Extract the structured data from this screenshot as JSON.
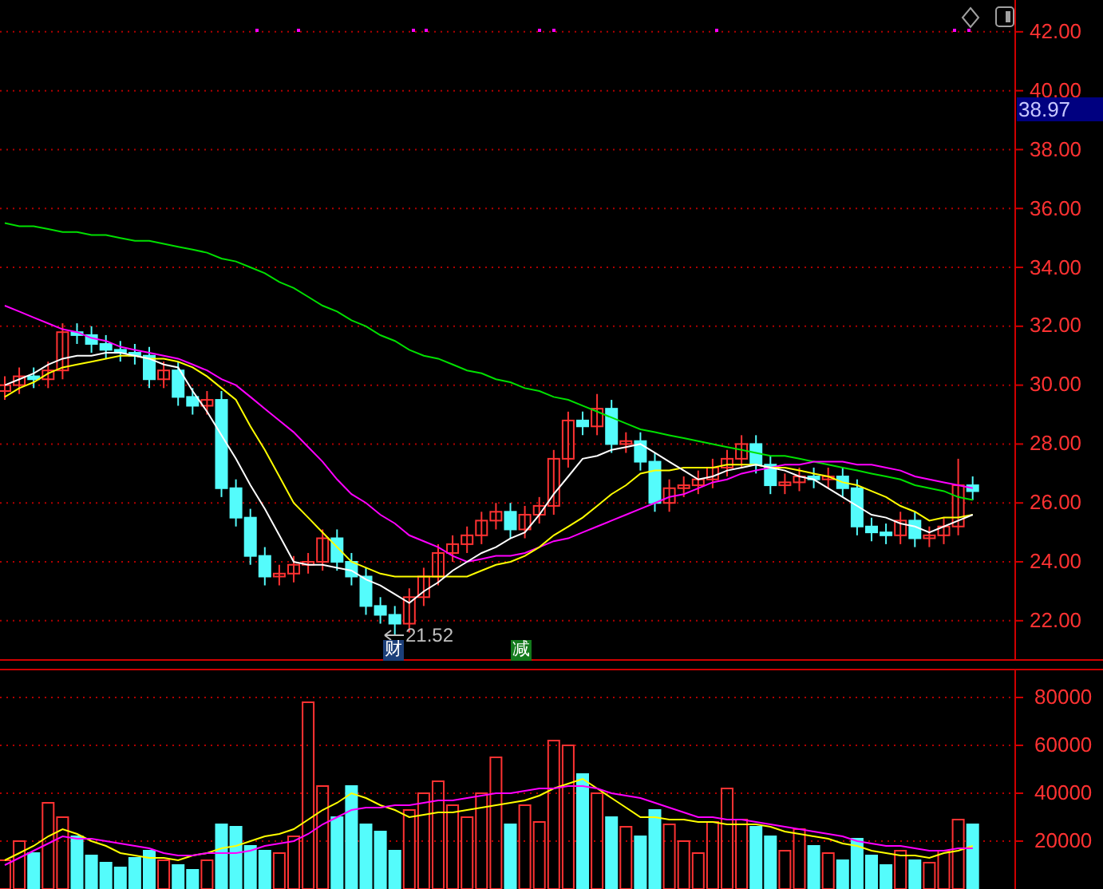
{
  "price_chart": {
    "chart_data": {
      "type": "candlestick",
      "grid": true,
      "ylim": [
        20.64,
        43.08
      ],
      "yticks": [
        {
          "value": 42,
          "label": "42.00"
        },
        {
          "value": 40,
          "label": "40.00"
        },
        {
          "value": 38,
          "label": "38.00"
        },
        {
          "value": 36,
          "label": "36.00"
        },
        {
          "value": 34,
          "label": "34.00"
        },
        {
          "value": 32,
          "label": "32.00"
        },
        {
          "value": 30,
          "label": "30.00"
        },
        {
          "value": 28,
          "label": "28.00"
        },
        {
          "value": 26,
          "label": "26.00"
        },
        {
          "value": 24,
          "label": "24.00"
        },
        {
          "value": 22,
          "label": "22.00"
        }
      ],
      "ohlc": [
        [
          29.8,
          30.3,
          29.5,
          30.0
        ],
        [
          30.0,
          30.6,
          29.7,
          30.3
        ],
        [
          30.3,
          30.6,
          29.9,
          30.2
        ],
        [
          30.2,
          30.8,
          29.9,
          30.5
        ],
        [
          30.5,
          32.1,
          30.2,
          31.8
        ],
        [
          31.8,
          32.1,
          31.4,
          31.7
        ],
        [
          31.7,
          32.0,
          31.1,
          31.4
        ],
        [
          31.4,
          31.7,
          30.9,
          31.2
        ],
        [
          31.2,
          31.5,
          30.8,
          31.1
        ],
        [
          31.1,
          31.4,
          30.7,
          31.0
        ],
        [
          31.0,
          31.3,
          29.9,
          30.2
        ],
        [
          30.2,
          30.8,
          29.9,
          30.5
        ],
        [
          30.5,
          30.8,
          29.3,
          29.6
        ],
        [
          29.6,
          29.9,
          29.0,
          29.3
        ],
        [
          29.3,
          29.8,
          29.0,
          29.5
        ],
        [
          29.5,
          29.8,
          26.2,
          26.5
        ],
        [
          26.5,
          26.8,
          25.2,
          25.5
        ],
        [
          25.5,
          25.8,
          23.9,
          24.2
        ],
        [
          24.2,
          24.5,
          23.2,
          23.5
        ],
        [
          23.5,
          23.9,
          23.2,
          23.6
        ],
        [
          23.6,
          24.2,
          23.3,
          23.9
        ],
        [
          23.9,
          24.3,
          23.6,
          24.0
        ],
        [
          24.0,
          25.1,
          23.7,
          24.8
        ],
        [
          24.8,
          25.1,
          23.7,
          24.0
        ],
        [
          24.0,
          24.3,
          23.2,
          23.5
        ],
        [
          23.5,
          23.8,
          22.2,
          22.5
        ],
        [
          22.5,
          22.8,
          21.9,
          22.2
        ],
        [
          22.2,
          22.5,
          21.52,
          21.9
        ],
        [
          21.9,
          23.1,
          21.6,
          22.8
        ],
        [
          22.8,
          23.8,
          22.5,
          23.5
        ],
        [
          23.5,
          24.6,
          23.2,
          24.3
        ],
        [
          24.3,
          24.9,
          24.0,
          24.6
        ],
        [
          24.6,
          25.2,
          24.3,
          24.9
        ],
        [
          24.9,
          25.7,
          24.6,
          25.4
        ],
        [
          25.4,
          26.0,
          25.1,
          25.7
        ],
        [
          25.7,
          26.0,
          24.8,
          25.1
        ],
        [
          25.1,
          25.9,
          24.8,
          25.6
        ],
        [
          25.6,
          26.2,
          25.3,
          25.9
        ],
        [
          25.9,
          27.8,
          25.6,
          27.5
        ],
        [
          27.5,
          29.1,
          27.2,
          28.8
        ],
        [
          28.8,
          29.1,
          28.3,
          28.6
        ],
        [
          28.6,
          29.7,
          28.3,
          29.2
        ],
        [
          29.2,
          29.5,
          27.7,
          28.0
        ],
        [
          28.0,
          28.4,
          27.7,
          28.1
        ],
        [
          28.1,
          28.4,
          27.1,
          27.4
        ],
        [
          27.4,
          27.7,
          25.7,
          26.0
        ],
        [
          26.0,
          26.8,
          25.7,
          26.5
        ],
        [
          26.5,
          26.9,
          26.2,
          26.6
        ],
        [
          26.6,
          27.1,
          26.3,
          26.8
        ],
        [
          26.8,
          27.5,
          26.5,
          27.2
        ],
        [
          27.2,
          27.8,
          26.9,
          27.5
        ],
        [
          27.5,
          28.3,
          27.2,
          28.0
        ],
        [
          28.0,
          28.3,
          27.0,
          27.3
        ],
        [
          27.3,
          27.6,
          26.3,
          26.6
        ],
        [
          26.6,
          27.0,
          26.3,
          26.7
        ],
        [
          26.7,
          27.2,
          26.4,
          26.9
        ],
        [
          26.9,
          27.2,
          26.5,
          26.8
        ],
        [
          26.8,
          27.2,
          26.5,
          26.9
        ],
        [
          26.9,
          27.2,
          26.2,
          26.5
        ],
        [
          26.5,
          26.8,
          24.9,
          25.2
        ],
        [
          25.2,
          25.5,
          24.7,
          25.0
        ],
        [
          25.0,
          25.3,
          24.6,
          24.9
        ],
        [
          24.9,
          25.7,
          24.6,
          25.4
        ],
        [
          25.4,
          25.7,
          24.5,
          24.8
        ],
        [
          24.8,
          25.2,
          24.5,
          24.9
        ],
        [
          24.9,
          25.5,
          24.6,
          25.2
        ],
        [
          25.2,
          27.5,
          24.9,
          26.6
        ],
        [
          26.6,
          26.9,
          26.1,
          26.4
        ]
      ],
      "series": [
        {
          "type": "line",
          "color": "#00e000",
          "values": [
            35.5,
            35.4,
            35.4,
            35.3,
            35.2,
            35.2,
            35.1,
            35.1,
            35.0,
            34.9,
            34.9,
            34.8,
            34.7,
            34.6,
            34.5,
            34.3,
            34.2,
            34.0,
            33.8,
            33.5,
            33.3,
            33.0,
            32.7,
            32.5,
            32.2,
            32.0,
            31.7,
            31.5,
            31.2,
            31.0,
            30.9,
            30.7,
            30.5,
            30.4,
            30.2,
            30.1,
            29.9,
            29.8,
            29.6,
            29.5,
            29.3,
            29.1,
            28.9,
            28.7,
            28.5,
            28.4,
            28.3,
            28.2,
            28.1,
            28.0,
            27.9,
            27.8,
            27.7,
            27.6,
            27.6,
            27.5,
            27.4,
            27.3,
            27.2,
            27.1,
            27.0,
            26.9,
            26.8,
            26.6,
            26.5,
            26.4,
            26.2,
            26.1
          ]
        },
        {
          "type": "line",
          "color": "#ff00ff",
          "values": [
            32.7,
            32.5,
            32.3,
            32.1,
            31.9,
            31.8,
            31.6,
            31.5,
            31.3,
            31.2,
            31.1,
            31.0,
            30.9,
            30.7,
            30.5,
            30.2,
            30.0,
            29.6,
            29.2,
            28.8,
            28.4,
            27.9,
            27.4,
            26.8,
            26.3,
            26.0,
            25.6,
            25.3,
            24.9,
            24.7,
            24.5,
            24.2,
            24.0,
            24.1,
            24.2,
            24.2,
            24.3,
            24.5,
            24.7,
            24.8,
            25.0,
            25.2,
            25.4,
            25.6,
            25.8,
            26.0,
            26.2,
            26.3,
            26.5,
            26.7,
            26.8,
            27.0,
            27.1,
            27.2,
            27.3,
            27.3,
            27.4,
            27.4,
            27.4,
            27.3,
            27.3,
            27.2,
            27.1,
            26.9,
            26.8,
            26.7,
            26.6,
            26.5
          ]
        },
        {
          "type": "line",
          "color": "#ffff00",
          "values": [
            29.6,
            29.9,
            30.1,
            30.4,
            30.6,
            30.7,
            30.8,
            30.9,
            31.0,
            31.0,
            30.9,
            30.9,
            30.8,
            30.6,
            30.3,
            29.9,
            29.5,
            28.6,
            27.8,
            26.9,
            26.0,
            25.5,
            25.0,
            24.5,
            24.0,
            23.8,
            23.6,
            23.5,
            23.5,
            23.5,
            23.5,
            23.5,
            23.5,
            23.7,
            23.9,
            24.0,
            24.2,
            24.5,
            24.9,
            25.2,
            25.5,
            25.9,
            26.3,
            26.6,
            27.0,
            27.1,
            27.1,
            27.2,
            27.2,
            27.2,
            27.3,
            27.3,
            27.3,
            27.2,
            27.2,
            27.1,
            27.0,
            26.9,
            26.7,
            26.6,
            26.4,
            26.2,
            25.9,
            25.7,
            25.4,
            25.5,
            25.5,
            25.6
          ]
        },
        {
          "type": "line",
          "color": "#ffffff",
          "values": [
            30.0,
            30.2,
            30.4,
            30.7,
            30.9,
            31.0,
            31.0,
            31.1,
            31.1,
            31.0,
            30.9,
            30.7,
            30.6,
            29.8,
            29.1,
            28.3,
            27.5,
            26.6,
            25.8,
            24.9,
            24.0,
            23.9,
            23.9,
            23.8,
            23.7,
            23.4,
            23.2,
            22.9,
            22.6,
            23.0,
            23.3,
            23.7,
            24.0,
            24.3,
            24.5,
            24.8,
            25.0,
            25.6,
            26.3,
            26.9,
            27.5,
            27.6,
            27.8,
            27.9,
            28.0,
            27.7,
            27.4,
            27.1,
            26.8,
            26.9,
            27.1,
            27.2,
            27.3,
            27.2,
            27.1,
            26.9,
            26.8,
            26.5,
            26.2,
            25.9,
            25.6,
            25.5,
            25.3,
            25.2,
            25.0,
            25.2,
            25.4,
            25.6
          ]
        }
      ]
    }
  },
  "current_price": "38.97",
  "low_marker": {
    "label": "21.52"
  },
  "event_badges": [
    {
      "label": "财",
      "color": "#1c3f7a"
    },
    {
      "label": "减",
      "color": "#137a1c"
    }
  ],
  "volume_chart": {
    "chart_data": {
      "type": "bar",
      "grid": true,
      "ylim": [
        0,
        92000
      ],
      "yticks": [
        {
          "value": 80000,
          "label": "80000"
        },
        {
          "value": 60000,
          "label": "60000"
        },
        {
          "value": 40000,
          "label": "40000"
        },
        {
          "value": 20000,
          "label": "20000"
        }
      ],
      "series": [
        {
          "color": "#ff3232",
          "values": [
            12000,
            20000,
            null,
            36000,
            30000,
            null,
            null,
            null,
            null,
            null,
            null,
            12000,
            null,
            null,
            12000,
            null,
            null,
            null,
            null,
            15000,
            22000,
            78000,
            43000,
            null,
            null,
            null,
            null,
            null,
            33000,
            40000,
            45000,
            35000,
            30000,
            40000,
            55000,
            null,
            35000,
            28000,
            62000,
            60000,
            null,
            40000,
            null,
            26000,
            null,
            null,
            27000,
            20000,
            15000,
            28000,
            42000,
            29000,
            null,
            null,
            16000,
            25000,
            null,
            15000,
            null,
            null,
            null,
            null,
            16000,
            null,
            11000,
            16000,
            29000,
            null
          ]
        },
        {
          "color": "#54fcfc",
          "values": [
            null,
            null,
            15000,
            null,
            null,
            22000,
            14000,
            11000,
            9000,
            13000,
            16000,
            null,
            10000,
            8000,
            null,
            27000,
            26000,
            18000,
            16000,
            null,
            null,
            null,
            null,
            30000,
            43000,
            27000,
            24000,
            16000,
            null,
            null,
            null,
            null,
            null,
            null,
            null,
            27000,
            null,
            null,
            null,
            null,
            48000,
            null,
            30000,
            null,
            22000,
            33000,
            null,
            null,
            null,
            null,
            null,
            null,
            26000,
            22000,
            null,
            null,
            18000,
            null,
            12000,
            21000,
            14000,
            10000,
            null,
            12000,
            null,
            null,
            null,
            27000
          ]
        },
        {
          "type": "line",
          "color": "#ffff00",
          "values": [
            12000,
            15000,
            18000,
            22000,
            25000,
            23000,
            20000,
            18000,
            15000,
            14000,
            13000,
            13000,
            12000,
            14000,
            15000,
            17000,
            18000,
            20000,
            22000,
            23000,
            25000,
            29000,
            33000,
            36000,
            40000,
            38000,
            35000,
            33000,
            30000,
            31000,
            32000,
            32000,
            33000,
            34000,
            35000,
            36000,
            37000,
            39000,
            42000,
            44000,
            46000,
            42000,
            38000,
            34000,
            30000,
            30000,
            29000,
            29000,
            28000,
            28000,
            27000,
            27000,
            27000,
            26000,
            24000,
            23000,
            22000,
            21000,
            19000,
            18000,
            16000,
            15000,
            14000,
            14000,
            13000,
            15000,
            16000,
            18000
          ]
        },
        {
          "type": "line",
          "color": "#ff00ff",
          "values": [
            10000,
            13000,
            16000,
            19000,
            22000,
            21000,
            21000,
            20000,
            19000,
            18000,
            17000,
            15000,
            14000,
            14000,
            15000,
            15000,
            15000,
            16000,
            18000,
            19000,
            20000,
            23000,
            27000,
            30000,
            33000,
            34000,
            34000,
            35000,
            35000,
            36000,
            37000,
            37000,
            38000,
            39000,
            40000,
            40000,
            41000,
            42000,
            42000,
            43000,
            43000,
            42000,
            40000,
            39000,
            38000,
            36000,
            34000,
            32000,
            30000,
            30000,
            29000,
            29000,
            28000,
            27000,
            26000,
            25000,
            24000,
            23000,
            22000,
            20000,
            19000,
            18000,
            18000,
            17000,
            16000,
            16000,
            17000,
            17000
          ]
        }
      ]
    }
  }
}
